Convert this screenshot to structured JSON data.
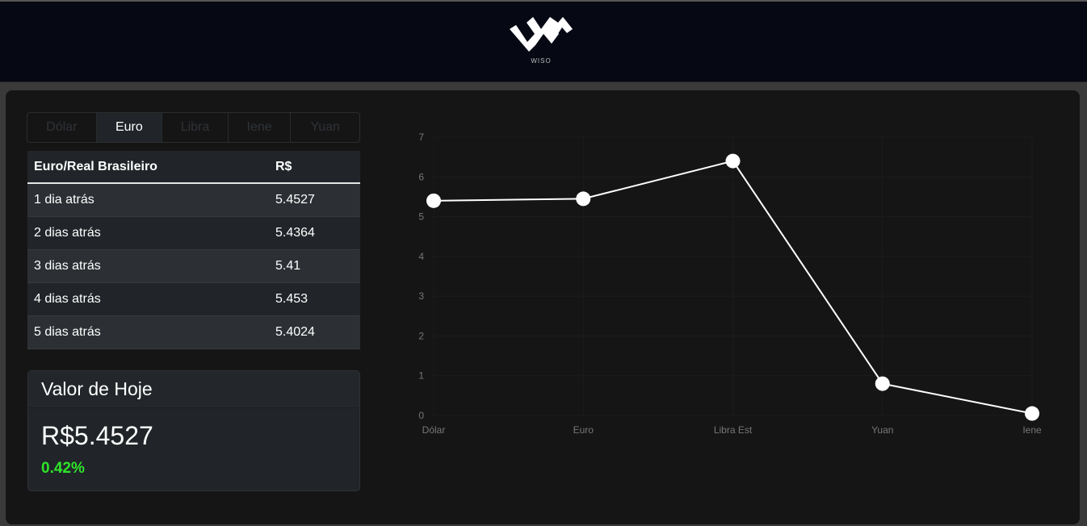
{
  "brand": {
    "logo_text": "WISO"
  },
  "tabs": [
    {
      "label": "Dólar",
      "active": false
    },
    {
      "label": "Euro",
      "active": true
    },
    {
      "label": "Libra",
      "active": false
    },
    {
      "label": "Iene",
      "active": false
    },
    {
      "label": "Yuan",
      "active": false
    }
  ],
  "table": {
    "headers": [
      "Euro/Real Brasileiro",
      "R$"
    ],
    "rows": [
      [
        "1 dia atrás",
        "5.4527"
      ],
      [
        "2 dias atrás",
        "5.4364"
      ],
      [
        "3 dias atrás",
        "5.41"
      ],
      [
        "4 dias atrás",
        "5.453"
      ],
      [
        "5 dias atrás",
        "5.4024"
      ]
    ]
  },
  "today": {
    "title": "Valor de Hoje",
    "value": "R$5.4527",
    "change": "0.42%",
    "change_color": "#2ee62a"
  },
  "chart_data": {
    "type": "line",
    "categories": [
      "Dólar",
      "Euro",
      "Libra Est",
      "Yuan",
      "Iene"
    ],
    "values": [
      5.4,
      5.45,
      6.4,
      0.8,
      0.05
    ],
    "ylim": [
      0,
      7
    ],
    "yticks": [
      0,
      1,
      2,
      3,
      4,
      5,
      6,
      7
    ],
    "line_color": "#ffffff",
    "grid": true,
    "title": "",
    "xlabel": "",
    "ylabel": ""
  }
}
